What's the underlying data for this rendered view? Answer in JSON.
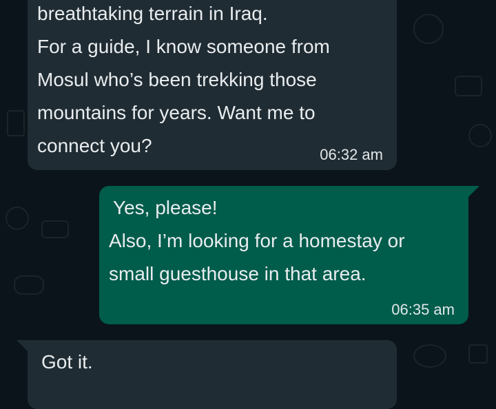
{
  "chat": {
    "messages": [
      {
        "direction": "incoming",
        "lines": [
          "breathtaking terrain in Iraq.",
          "For a guide, I know someone from",
          "Mosul who’s been trekking those",
          "mountains for years. Want me to",
          "connect you?"
        ],
        "time": "06:32 am"
      },
      {
        "direction": "outgoing",
        "lines": [
          "Yes, please!",
          "Also, I’m looking for a homestay or",
          "small guesthouse in that area."
        ],
        "time": "06:35 am"
      },
      {
        "direction": "incoming",
        "lines": [
          "Got it."
        ],
        "time": ""
      }
    ]
  },
  "theme": {
    "background": "#0b141a",
    "incoming_bubble": "#202c33",
    "outgoing_bubble": "#005c4b",
    "text": "#e9edef"
  }
}
